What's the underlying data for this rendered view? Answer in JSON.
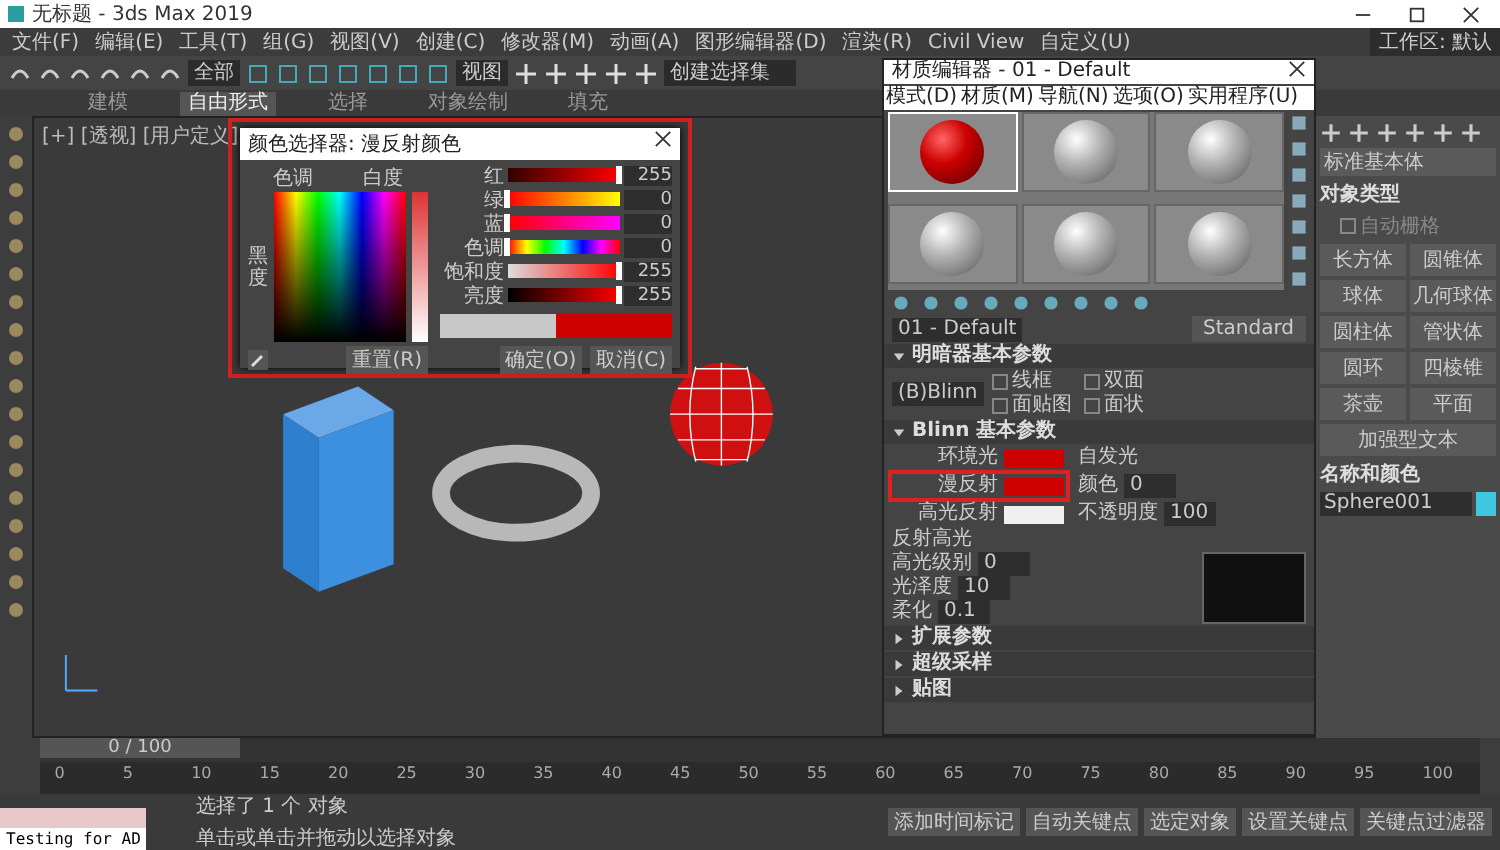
{
  "window": {
    "title": "无标题 - 3ds Max 2019"
  },
  "menu": [
    "文件(F)",
    "编辑(E)",
    "工具(T)",
    "组(G)",
    "视图(V)",
    "创建(C)",
    "修改器(M)",
    "动画(A)",
    "图形编辑器(D)",
    "渲染(R)",
    "Civil View",
    "自定义(U)"
  ],
  "toolbar": {
    "selection_filter": "全部",
    "reference": "视图",
    "selection_set": "创建选择集"
  },
  "ribbon_tabs": [
    {
      "label": "建模",
      "selected": false
    },
    {
      "label": "自由形式",
      "selected": true
    },
    {
      "label": "选择",
      "selected": false
    },
    {
      "label": "对象绘制",
      "selected": false
    },
    {
      "label": "填充",
      "selected": false
    }
  ],
  "workspace": {
    "label": "工作区: 默认"
  },
  "viewport": {
    "label": "[+] [透视] [用户定义]"
  },
  "color_dialog": {
    "title": "颜色选择器: 漫反射颜色",
    "hue_label": "色调",
    "whiteness_label": "白度",
    "blackness_label": "黑度",
    "channels": [
      {
        "name": "红",
        "value": "255",
        "level": 1
      },
      {
        "name": "绿",
        "value": "0",
        "level": 0
      },
      {
        "name": "蓝",
        "value": "0",
        "level": 0
      },
      {
        "name": "色调",
        "value": "0",
        "level": 0
      },
      {
        "name": "饱和度",
        "value": "255",
        "level": 1
      },
      {
        "name": "亮度",
        "value": "255",
        "level": 1
      }
    ],
    "buttons": [
      "重置(R)",
      "确定(O)",
      "取消(C)"
    ]
  },
  "material_editor": {
    "title": "材质编辑器 - 01 - Default",
    "menu": [
      "模式(D)",
      "材质(M)",
      "导航(N)",
      "选项(O)",
      "实用程序(U)"
    ],
    "slots": [
      {
        "selected": true
      },
      {
        "selected": false
      },
      {
        "selected": false
      },
      {
        "selected": false
      },
      {
        "selected": false
      },
      {
        "selected": false
      }
    ],
    "material_name": "01 - Default",
    "material_type": "Standard",
    "shader_rollout": "明暗器基本参数",
    "shader": "(B)Blinn",
    "shader_options": [
      {
        "label": "线框",
        "checked": false
      },
      {
        "label": "双面",
        "checked": false
      },
      {
        "label": "面贴图",
        "checked": false
      },
      {
        "label": "面状",
        "checked": false
      }
    ],
    "blinn_rollout": "Blinn 基本参数",
    "colors": [
      {
        "label": "环境光",
        "color": "#d00000"
      },
      {
        "label": "漫反射",
        "color": "#d00000"
      },
      {
        "label": "高光反射",
        "color": "#f0f0f0"
      }
    ],
    "self_illum": {
      "title": "自发光",
      "label": "颜色",
      "value": "0"
    },
    "opacity": {
      "label": "不透明度",
      "value": "100"
    },
    "highlights": {
      "title": "反射高光",
      "rows": [
        {
          "label": "高光级别",
          "value": "0"
        },
        {
          "label": "光泽度",
          "value": "10"
        },
        {
          "label": "柔化",
          "value": "0.1"
        }
      ]
    },
    "rollouts": [
      "扩展参数",
      "超级采样",
      "贴图"
    ]
  },
  "command_panel": {
    "category": "标准基本体",
    "object_type": "对象类型",
    "auto_grid": {
      "label": "自动栅格",
      "checked": false
    },
    "objects": [
      "长方体",
      "圆锥体",
      "球体",
      "几何球体",
      "圆柱体",
      "管状体",
      "圆环",
      "四棱锥",
      "茶壶",
      "平面",
      "加强型文本"
    ],
    "name_color": "名称和颜色",
    "object_name": "Sphere001"
  },
  "timeline": {
    "frame": "0 / 100",
    "level": 0,
    "ticks": [
      "0",
      "5",
      "10",
      "15",
      "20",
      "25",
      "30",
      "35",
      "40",
      "45",
      "50",
      "55",
      "60",
      "65",
      "70",
      "75",
      "80",
      "85",
      "90",
      "95",
      "100"
    ]
  },
  "status": {
    "script_label": "Testing for AD",
    "selected": "选择了 1 个 对象",
    "hint": "单击或单击并拖动以选择对象",
    "add_marker": "添加时间标记",
    "auto_key": "自动关键点",
    "key_target": "选定对象",
    "set_key": "设置关键点",
    "key_filters": "关键点过滤器"
  }
}
